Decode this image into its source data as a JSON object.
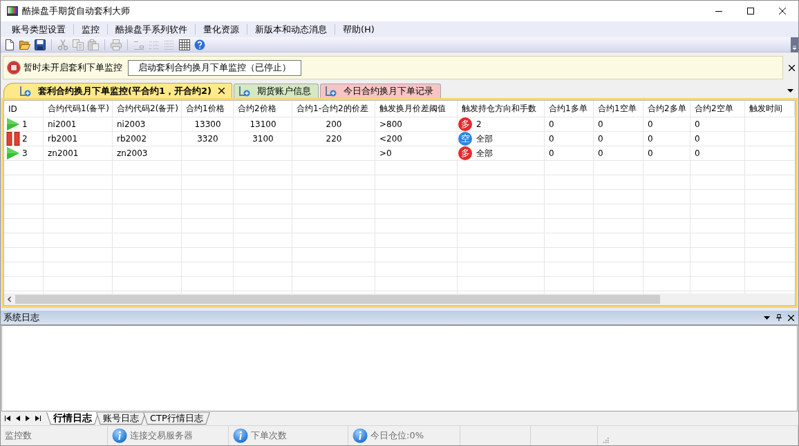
{
  "window": {
    "title": "酷操盘手期货自动套利大师"
  },
  "menu": [
    {
      "label": "账号类型设置"
    },
    {
      "label": "监控"
    },
    {
      "label": "酷操盘手系列软件"
    },
    {
      "label": "量化资源"
    },
    {
      "label": "新版本和动态消息"
    },
    {
      "label": "帮助(H)"
    }
  ],
  "toolbar": [
    {
      "kind": "new",
      "disabled": false
    },
    {
      "kind": "open",
      "disabled": false
    },
    {
      "kind": "save",
      "disabled": false
    },
    {
      "kind": "separator"
    },
    {
      "kind": "cut",
      "disabled": true
    },
    {
      "kind": "copy",
      "disabled": true
    },
    {
      "kind": "paste",
      "disabled": true
    },
    {
      "kind": "separator"
    },
    {
      "kind": "print",
      "disabled": true
    },
    {
      "kind": "separator"
    },
    {
      "kind": "align",
      "disabled": true
    },
    {
      "kind": "indent",
      "disabled": true
    },
    {
      "kind": "list",
      "disabled": true
    },
    {
      "kind": "table",
      "disabled": false
    },
    {
      "kind": "help",
      "disabled": false
    }
  ],
  "notice": {
    "message": "暂时未开启套利下单监控",
    "button": "启动套利合约换月下单监控（已停止）",
    "running": false
  },
  "tabs": [
    {
      "label": "套利合约换月下单监控(平合约1，开合约2)",
      "selected": true,
      "closable": true,
      "color": "#ffe98a"
    },
    {
      "label": "期货账户信息",
      "selected": false,
      "closable": false,
      "color": "#d4e8c2"
    },
    {
      "label": "今日合约换月下单记录",
      "selected": false,
      "closable": false,
      "color": "#f8c4c4"
    }
  ],
  "table": {
    "columns": [
      "ID",
      "合约代码1(备平)",
      "合约代码2(备开)",
      "合约1价格",
      "合约2价格",
      "合约1-合约2的价差",
      "触发换月价差阈值",
      "触发持仓方向和手数",
      "合约1多单",
      "合约1空单",
      "合约2多单",
      "合约2空单",
      "触发时间"
    ],
    "rows": [
      {
        "id": "1",
        "kind": "running",
        "contract_1": "ni2001",
        "contract_2": "ni2003",
        "price_1": "13300",
        "price_2": "13100",
        "spread": "200",
        "threshold": ">800",
        "direction": {
          "label": "多",
          "color": "#e8282b"
        },
        "lots": "2",
        "c1_long": "0",
        "c1_short": "0",
        "c2_long": "0",
        "c2_short": "0"
      },
      {
        "id": "2",
        "kind": "paused",
        "contract_1": "rb2001",
        "contract_2": "rb2002",
        "price_1": "3320",
        "price_2": "3100",
        "spread": "220",
        "threshold": "<200",
        "direction": {
          "label": "空",
          "color": "#2b86e6"
        },
        "lots": "全部",
        "c1_long": "0",
        "c1_short": "0",
        "c2_long": "0",
        "c2_short": "0"
      },
      {
        "id": "3",
        "kind": "running",
        "contract_1": "zn2001",
        "contract_2": "zn2003",
        "threshold": ">0",
        "direction": {
          "label": "多",
          "color": "#e8282b"
        },
        "lots": "全部",
        "c1_long": "0",
        "c1_short": "0",
        "c2_long": "0",
        "c2_short": "0"
      }
    ]
  },
  "log_panel": {
    "title": "系统日志",
    "tabs": [
      {
        "label": "行情日志",
        "selected": true
      },
      {
        "label": "账号日志",
        "selected": false
      },
      {
        "label": "CTP行情日志",
        "selected": false
      }
    ]
  },
  "status_bar": [
    {
      "text": "监控数",
      "kind": "plain"
    },
    {
      "text": "连接交易服务器",
      "kind": "info"
    },
    {
      "text": "下单次数",
      "kind": "info"
    },
    {
      "text": "今日仓位:0%",
      "kind": "info"
    }
  ]
}
